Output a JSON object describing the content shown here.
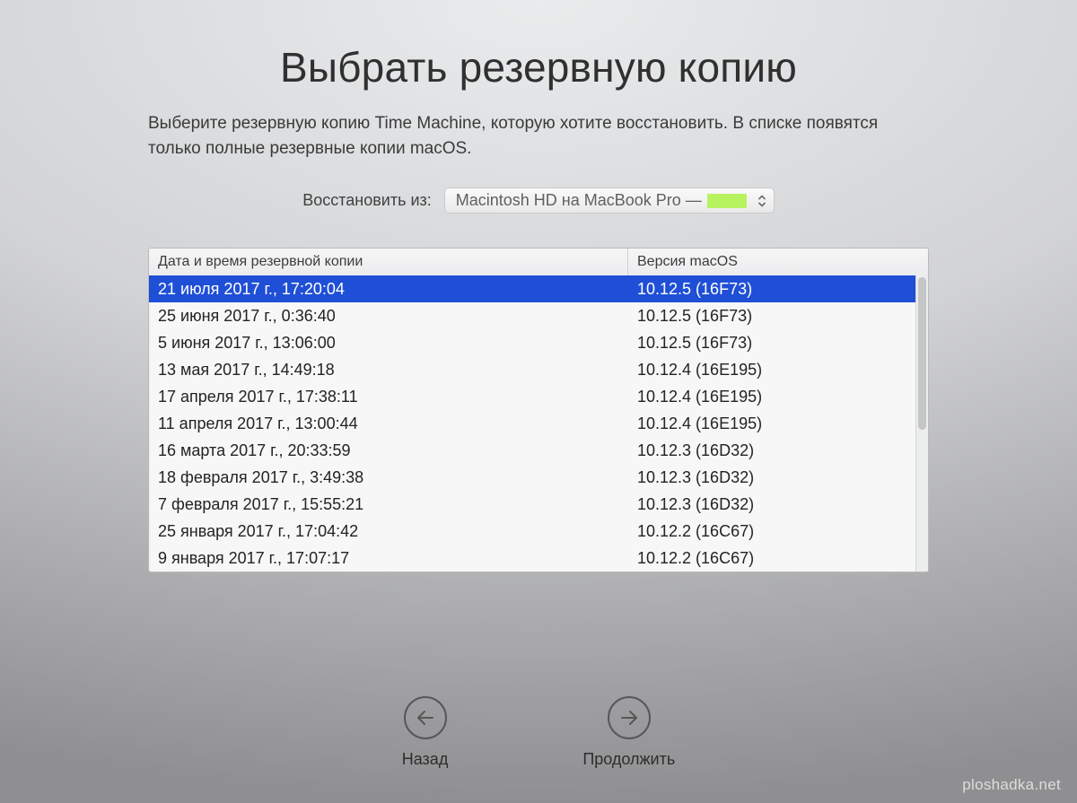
{
  "title": "Выбрать резервную копию",
  "subtitle": "Выберите резервную копию Time Machine, которую хотите восстановить. В списке появятся только полные резервные копии macOS.",
  "source": {
    "label": "Восстановить из:",
    "selected": "Macintosh HD на MacBook Pro —"
  },
  "table": {
    "headers": {
      "date": "Дата и время резервной копии",
      "version": "Версия macOS"
    },
    "rows": [
      {
        "date": "21 июля 2017 г., 17:20:04",
        "version": "10.12.5 (16F73)",
        "selected": true
      },
      {
        "date": "25 июня 2017 г., 0:36:40",
        "version": "10.12.5 (16F73)",
        "selected": false
      },
      {
        "date": "5 июня 2017 г., 13:06:00",
        "version": "10.12.5 (16F73)",
        "selected": false
      },
      {
        "date": "13 мая 2017 г., 14:49:18",
        "version": "10.12.4 (16E195)",
        "selected": false
      },
      {
        "date": "17 апреля 2017 г., 17:38:11",
        "version": "10.12.4 (16E195)",
        "selected": false
      },
      {
        "date": "11 апреля 2017 г., 13:00:44",
        "version": "10.12.4 (16E195)",
        "selected": false
      },
      {
        "date": "16 марта 2017 г., 20:33:59",
        "version": "10.12.3 (16D32)",
        "selected": false
      },
      {
        "date": "18 февраля 2017 г., 3:49:38",
        "version": "10.12.3 (16D32)",
        "selected": false
      },
      {
        "date": "7 февраля 2017 г., 15:55:21",
        "version": "10.12.3 (16D32)",
        "selected": false
      },
      {
        "date": "25 января 2017 г., 17:04:42",
        "version": "10.12.2 (16C67)",
        "selected": false
      },
      {
        "date": "9 января 2017 г., 17:07:17",
        "version": "10.12.2 (16C67)",
        "selected": false
      }
    ]
  },
  "nav": {
    "back": "Назад",
    "continue": "Продолжить"
  },
  "watermark": "ploshadka.net"
}
